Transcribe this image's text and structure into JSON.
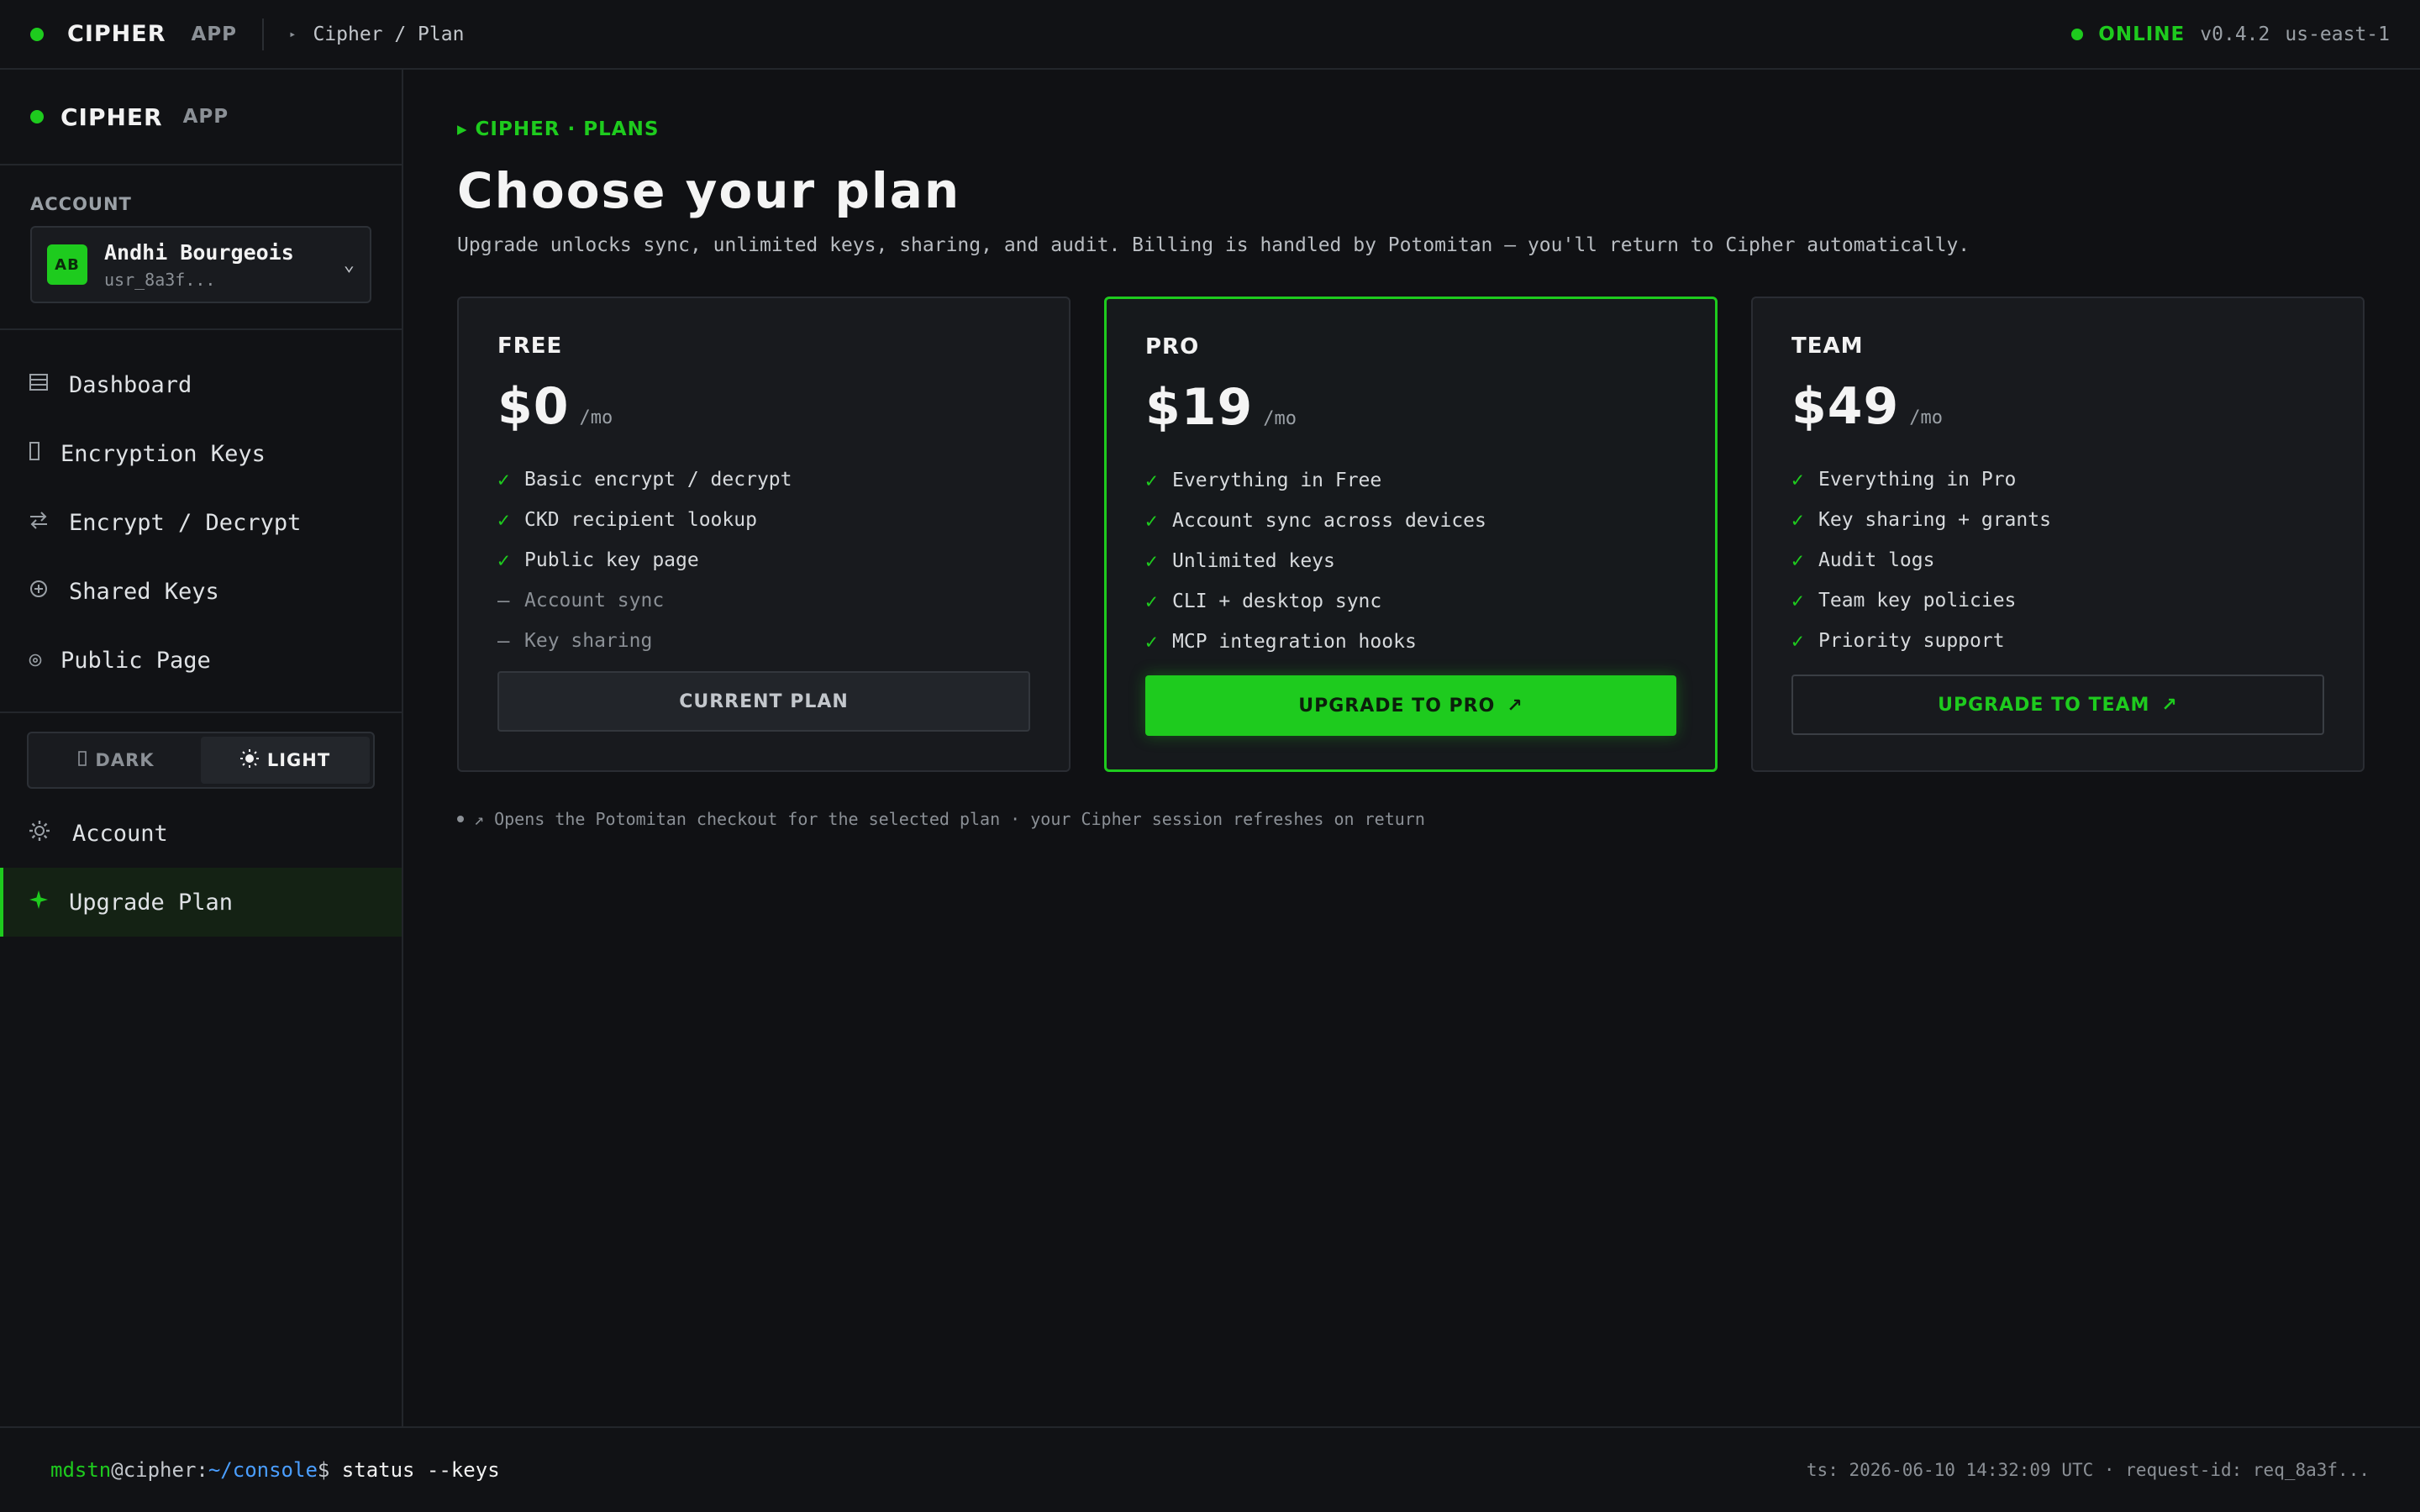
{
  "topbar": {
    "brand": "CIPHER",
    "app": "APP",
    "crumb_caret": "▸",
    "breadcrumb": "Cipher / Plan",
    "status": "ONLINE",
    "version": "v0.4.2",
    "region": "us-east-1"
  },
  "sidebar": {
    "brand": "CIPHER",
    "app": "APP",
    "account_label": "ACCOUNT",
    "account": {
      "initials": "AB",
      "name": "Andhi Bourgeois",
      "id": "usr_8a3f..."
    },
    "nav": [
      {
        "label": "Dashboard",
        "icon": "dashboard-icon"
      },
      {
        "label": "Encryption Keys",
        "icon": "key-icon"
      },
      {
        "label": "Encrypt / Decrypt",
        "icon": "swap-icon"
      },
      {
        "label": "Shared Keys",
        "icon": "share-icon"
      },
      {
        "label": "Public Page",
        "icon": "globe-icon"
      }
    ],
    "theme": {
      "dark": "DARK",
      "light": "LIGHT",
      "selected": "LIGHT"
    },
    "nav_bottom": [
      {
        "label": "Account",
        "icon": "gear-icon"
      },
      {
        "label": "Upgrade Plan",
        "icon": "sparkle-icon",
        "active": true
      }
    ]
  },
  "main": {
    "eyebrow": "▸ CIPHER · PLANS",
    "title": "Choose your plan",
    "subtitle": "Upgrade unlocks sync, unlimited keys, sharing, and audit. Billing is handled by Potomitan — you'll return to Cipher automatically.",
    "plans": [
      {
        "tier": "FREE",
        "price": "$0",
        "per": "/mo",
        "features": [
          {
            "text": "Basic encrypt / decrypt",
            "included": true
          },
          {
            "text": "CKD recipient lookup",
            "included": true
          },
          {
            "text": "Public key page",
            "included": true
          },
          {
            "text": "Account sync",
            "included": false
          },
          {
            "text": "Key sharing",
            "included": false
          }
        ],
        "button": "CURRENT PLAN"
      },
      {
        "tier": "PRO",
        "price": "$19",
        "per": "/mo",
        "features": [
          {
            "text": "Everything in Free",
            "included": true
          },
          {
            "text": "Account sync across devices",
            "included": true
          },
          {
            "text": "Unlimited keys",
            "included": true
          },
          {
            "text": "CLI + desktop sync",
            "included": true
          },
          {
            "text": "MCP integration hooks",
            "included": true
          }
        ],
        "button": "UPGRADE TO PRO"
      },
      {
        "tier": "TEAM",
        "price": "$49",
        "per": "/mo",
        "features": [
          {
            "text": "Everything in Pro",
            "included": true
          },
          {
            "text": "Key sharing + grants",
            "included": true
          },
          {
            "text": "Audit logs",
            "included": true
          },
          {
            "text": "Team key policies",
            "included": true
          },
          {
            "text": "Priority support",
            "included": true
          }
        ],
        "button": "UPGRADE TO TEAM"
      }
    ],
    "footnote": "↗ Opens the Potomitan checkout for the selected plan · your Cipher session refreshes on return"
  },
  "terminal": {
    "user": "mdstn",
    "host": "@cipher:",
    "path": "~/console",
    "prompt": "$ ",
    "command": "status --keys",
    "meta": "ts: 2026-06-10 14:32:09 UTC · request-id: req_8a3f..."
  },
  "icons": {
    "check": "✓",
    "dash": "—",
    "arrow": "↗",
    "chevron": "⌄"
  },
  "colors": {
    "accent": "#1ecb1e",
    "background": "#101114",
    "panel": "#181a1e",
    "link": "#4a9eff"
  }
}
